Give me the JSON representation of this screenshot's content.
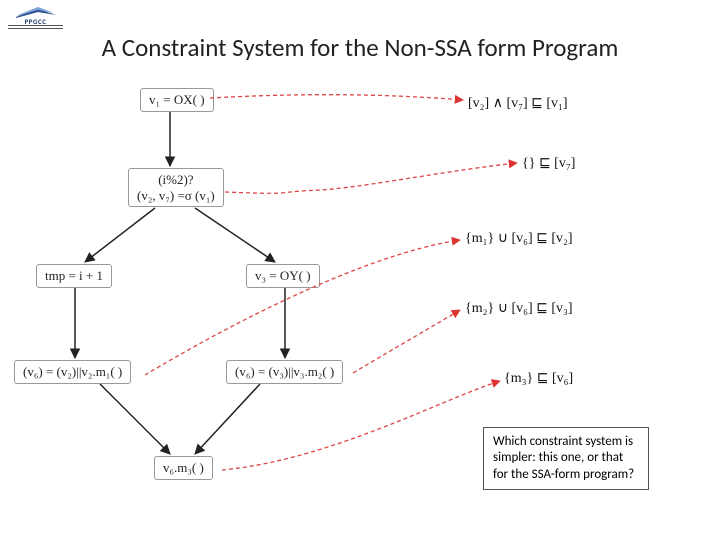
{
  "logo": {
    "text": "PPGCC",
    "sub": ""
  },
  "title": "A Constraint System for the Non-SSA form Program",
  "nodes": {
    "n1": "v₁ = OX( )",
    "n2a": "(i%2)?",
    "n2b": "(v₂, v₇) =σ (v₁)",
    "n3": "tmp = i + 1",
    "n4": "v₃ = OY( )",
    "n5": "(v₆) = (v₂)||v₂.m₁( )",
    "n6": "(v₆) = (v₃)||v₃.m₂( )",
    "n7": "v₆.m₃( )"
  },
  "constraints": {
    "c1": "[v₂] ∧ [v₇] ⊑ [v₁]",
    "c2": "{} ⊑ [v₇]",
    "c3": "{m₁} ∪ [v₆] ⊑ [v₂]",
    "c4": "{m₂} ∪ [v₆] ⊑ [v₃]",
    "c5": "{m₃} ⊑ [v₆]"
  },
  "callout": "Which constraint system is simpler: this one, or that for the SSA-form program?"
}
